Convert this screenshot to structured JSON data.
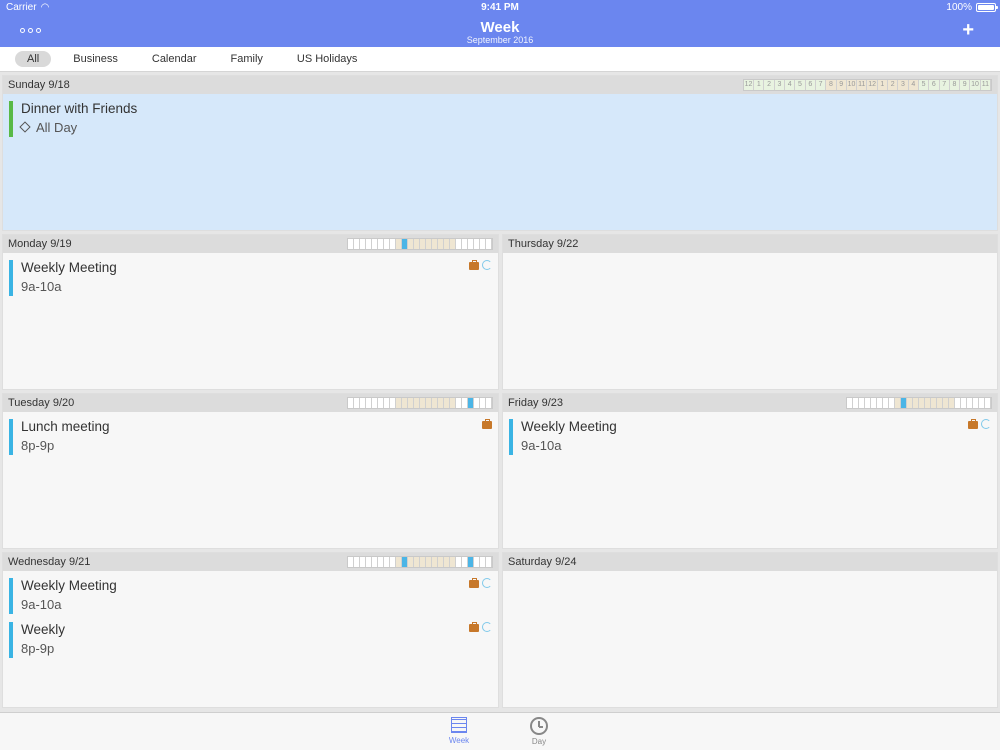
{
  "status": {
    "carrier": "Carrier",
    "time": "9:41 PM",
    "battery": "100%"
  },
  "header": {
    "title": "Week",
    "subtitle": "September 2016",
    "add_label": "+"
  },
  "filters": [
    "All",
    "Business",
    "Calendar",
    "Family",
    "US Holidays"
  ],
  "hour_labels": [
    "12",
    "1",
    "2",
    "3",
    "4",
    "5",
    "6",
    "7",
    "8",
    "9",
    "10",
    "11",
    "12",
    "1",
    "2",
    "3",
    "4",
    "5",
    "6",
    "7",
    "8",
    "9",
    "10",
    "11"
  ],
  "days": {
    "sunday": {
      "label": "Sunday 9/18",
      "events": [
        {
          "name": "Dinner with Friends",
          "time": "All Day"
        }
      ]
    },
    "monday": {
      "label": "Monday 9/19",
      "events": [
        {
          "name": "Weekly Meeting",
          "time": "9a-10a"
        }
      ]
    },
    "tuesday": {
      "label": "Tuesday 9/20",
      "events": [
        {
          "name": "Lunch meeting",
          "time": "8p-9p"
        }
      ]
    },
    "wednesday": {
      "label": "Wednesday 9/21",
      "events": [
        {
          "name": "Weekly Meeting",
          "time": "9a-10a"
        },
        {
          "name": "Weekly",
          "time": "8p-9p"
        }
      ]
    },
    "thursday": {
      "label": "Thursday 9/22",
      "events": []
    },
    "friday": {
      "label": "Friday 9/23",
      "events": [
        {
          "name": "Weekly Meeting",
          "time": "9a-10a"
        }
      ]
    },
    "saturday": {
      "label": "Saturday 9/24",
      "events": []
    }
  },
  "tabs": {
    "week": "Week",
    "day": "Day"
  }
}
